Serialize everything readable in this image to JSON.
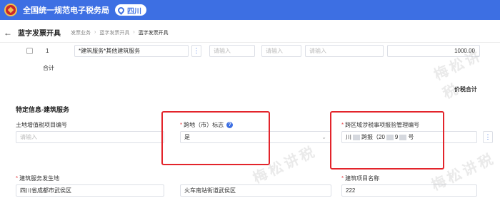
{
  "header": {
    "app_title": "全国统一规范电子税务局",
    "region": "四川"
  },
  "titlebar": {
    "page_title": "蓝字发票开具",
    "breadcrumb": [
      "发票业务",
      "蓝字发票开具",
      "蓝字发票开具"
    ]
  },
  "line_item": {
    "seq": "1",
    "item_name": "*建筑服务*其他建筑服务",
    "field_placeholder_1": "请输入",
    "field_placeholder_2": "请输入",
    "field_placeholder_3": "请输入",
    "amount": "1000.00"
  },
  "subtotal_label": "合计",
  "price_tax_total_label": "价税合计",
  "special_section": {
    "title": "特定信息-建筑服务",
    "land_vat_label": "土地增值税项目编号",
    "land_vat_placeholder": "请输入",
    "cross_region_label": "跨地（市）标志",
    "cross_region_value": "是",
    "cross_region_mgmt_label": "跨区域涉税事项报验管理编号",
    "cross_region_mgmt_value_prefix": "川",
    "cross_region_mgmt_value_mid": "跨报（20",
    "cross_region_mgmt_value_mid2": "9",
    "cross_region_mgmt_value_suffix": "号",
    "service_location_label": "建筑服务发生地",
    "service_location_value": "四川省成都市武侯区",
    "service_address_value": "火车南站街道武侯区",
    "project_name_label": "建筑项目名称",
    "project_name_value": "222"
  },
  "watermark_text": "梅松讲税",
  "colors": {
    "brand_blue": "#3d6fe3",
    "highlight_red": "#e3242b",
    "required_red": "#e5484d"
  }
}
